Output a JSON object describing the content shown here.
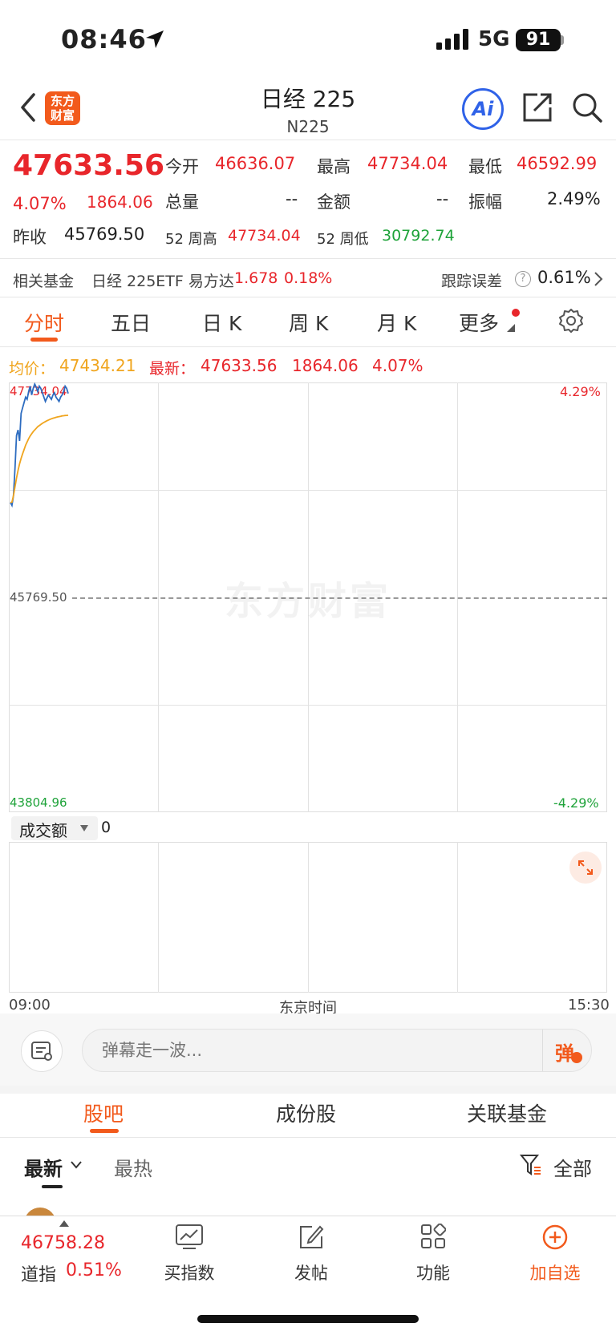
{
  "status": {
    "time": "08:46",
    "network": "5G",
    "battery": "91"
  },
  "header": {
    "logo": "东方财富",
    "title": "日经 225",
    "subtitle": "N225",
    "ai_label": "Ai"
  },
  "quote": {
    "price": "47633.56",
    "change_pct": "4.07%",
    "change": "1864.06",
    "open_label": "今开",
    "open": "46636.07",
    "high_label": "最高",
    "high": "47734.04",
    "low_label": "最低",
    "low": "46592.99",
    "volume_label": "总量",
    "volume": "--",
    "amount_label": "金额",
    "amount": "--",
    "amplitude_label": "振幅",
    "amplitude": "2.49%",
    "prev_close_label": "昨收",
    "prev_close": "45769.50",
    "w52_high_label": "52 周高",
    "w52_high": "47734.04",
    "w52_low_label": "52 周低",
    "w52_low": "30792.74"
  },
  "fund": {
    "label": "相关基金",
    "name": "日经 225ETF 易方达",
    "price": "1.678",
    "pct": "0.18%",
    "tracking_label": "跟踪误差",
    "tracking": "0.61%"
  },
  "tabs": [
    "分时",
    "五日",
    "日 K",
    "周 K",
    "月 K",
    "更多"
  ],
  "legend": {
    "avg_label": "均价：",
    "avg": "47434.21",
    "latest_label": "最新：",
    "latest": "47633.56",
    "change": "1864.06",
    "pct": "4.07%"
  },
  "chart_data": {
    "type": "line",
    "y_labels": {
      "top": "47734.04",
      "mid": "45769.50",
      "bottom": "43804.96",
      "top_pct": "4.29%",
      "bottom_pct": "-4.29%"
    },
    "ylim": [
      43804.96,
      47734.04
    ],
    "x_labels": {
      "start": "09:00",
      "center": "东京时间",
      "end": "15:30"
    },
    "series": [
      {
        "color": "#2d6cc0",
        "values": [
          46636,
          46610,
          46700,
          46950,
          47250,
          47300,
          47200,
          47450,
          47500,
          47550,
          47600,
          47580,
          47650,
          47700,
          47620,
          47680,
          47734,
          47690,
          47650,
          47700,
          47680,
          47640,
          47600,
          47560,
          47590,
          47620,
          47600,
          47580,
          47620,
          47640,
          47600,
          47580,
          47560,
          47600,
          47620,
          47650,
          47700,
          47680,
          47633
        ]
      },
      {
        "color": "#f0a51e",
        "values": [
          46636,
          46640,
          46700,
          46780,
          46860,
          46930,
          46990,
          47040,
          47080,
          47120,
          47160,
          47190,
          47220,
          47245,
          47265,
          47285,
          47300,
          47315,
          47330,
          47340,
          47350,
          47360,
          47368,
          47376,
          47384,
          47390,
          47396,
          47402,
          47407,
          47411,
          47415,
          47419,
          47422,
          47425,
          47428,
          47430,
          47432,
          47433,
          47434
        ]
      }
    ]
  },
  "volume": {
    "label": "成交额",
    "value": "0"
  },
  "comment": {
    "placeholder": "弹幕走一波...",
    "danmu": "弹"
  },
  "sections": [
    "股吧",
    "成份股",
    "关联基金"
  ],
  "filters": {
    "latest": "最新",
    "hot": "最热",
    "all": "全部"
  },
  "bottom": {
    "dow_value": "46758.28",
    "dow_label": "道指",
    "dow_pct": "0.51%",
    "items": [
      "买指数",
      "发帖",
      "功能",
      "加自选"
    ]
  },
  "colors": {
    "accent": "#f25a1c",
    "up": "#e8262b",
    "down": "#1fa33a",
    "avg": "#f0a51e",
    "line": "#2d6cc0"
  }
}
